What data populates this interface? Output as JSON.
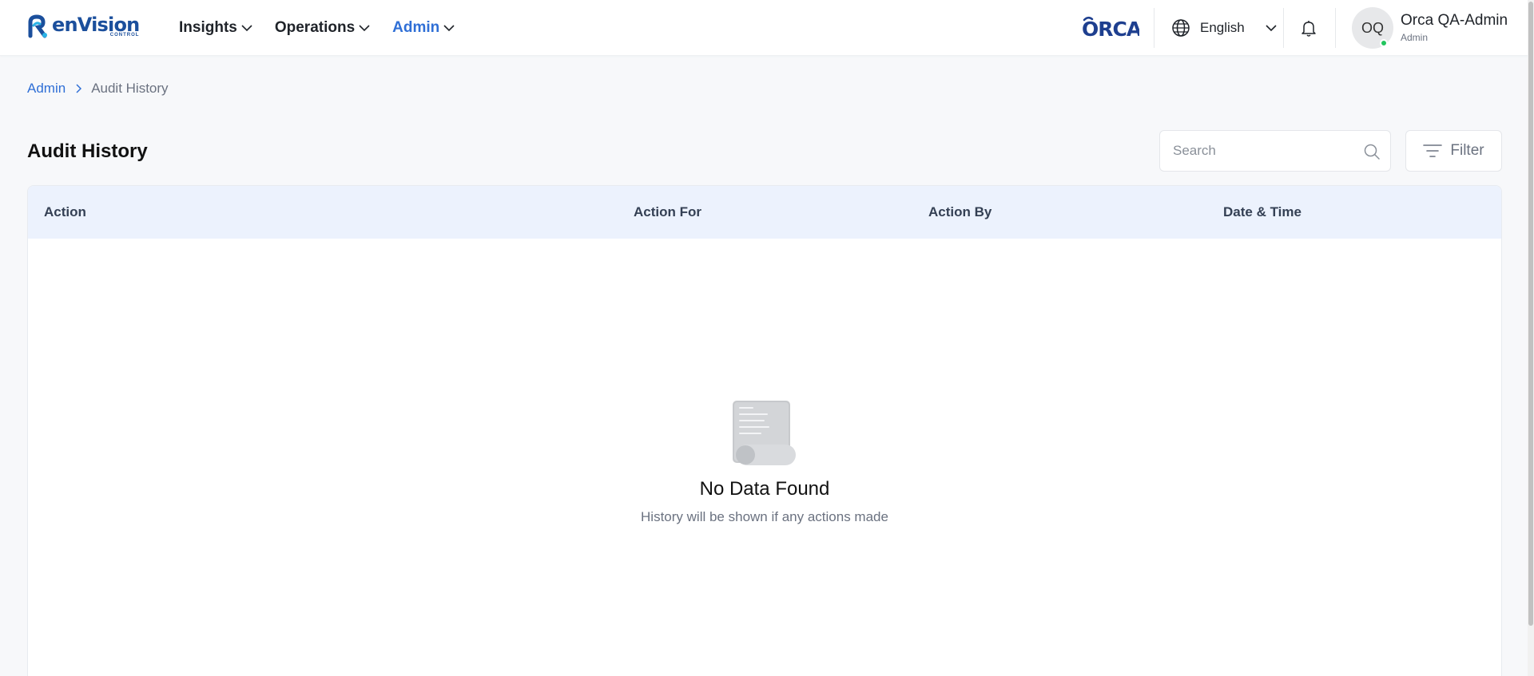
{
  "brand": {
    "name": "enVision",
    "sub": "CONTROL",
    "partner": "ORCA"
  },
  "nav": [
    {
      "label": "Insights",
      "active": false
    },
    {
      "label": "Operations",
      "active": false
    },
    {
      "label": "Admin",
      "active": true
    }
  ],
  "language": {
    "label": "English"
  },
  "user": {
    "initials": "OQ",
    "name": "Orca QA-Admin",
    "role": "Admin",
    "online": true
  },
  "breadcrumb": {
    "parent": "Admin",
    "current": "Audit History"
  },
  "page": {
    "title": "Audit History"
  },
  "search": {
    "placeholder": "Search"
  },
  "filter": {
    "label": "Filter"
  },
  "table": {
    "columns": [
      "Action",
      "Action For",
      "Action By",
      "Date & Time"
    ],
    "rows": []
  },
  "empty_state": {
    "title": "No Data Found",
    "subtitle": "History will be shown if any actions made"
  },
  "colors": {
    "accent": "#2f6fd6",
    "header_row": "#ecf2fd",
    "online": "#22c55e"
  }
}
